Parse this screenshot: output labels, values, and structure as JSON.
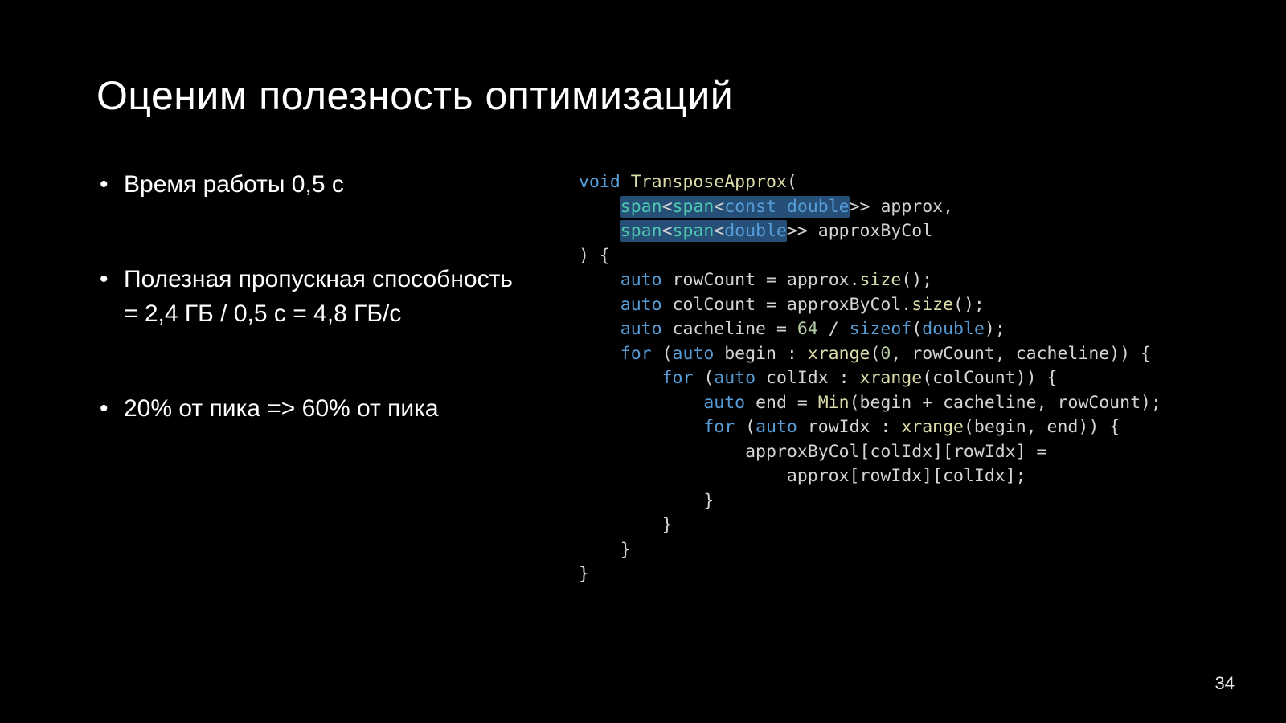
{
  "slide": {
    "title": "Оценим полезность оптимизаций",
    "bullets": [
      "Время работы 0,5 с",
      "Полезная пропускная способность = 2,4 ГБ / 0,5 с = 4,8 ГБ/с",
      "20% от пика => 60% от пика"
    ],
    "page_number": "34"
  },
  "code": {
    "l1": {
      "kw_void": "void",
      "fn": "TransposeApprox",
      "open": "("
    },
    "l2": {
      "hl_span1": "span",
      "hl_lt1": "<",
      "hl_span2": "span",
      "hl_lt2": "<",
      "hl_const": "const",
      "hl_sp": " ",
      "hl_double": "double",
      "gtgt": ">>",
      "param": " approx,"
    },
    "l3": {
      "hl_span1": "span",
      "hl_lt1": "<",
      "hl_span2": "span",
      "hl_lt2": "<",
      "hl_double": "double",
      "gtgt": ">>",
      "param": " approxByCol"
    },
    "l4": {
      "txt": ") {"
    },
    "l5": {
      "kw_auto": "auto",
      "var": " rowCount ",
      "eq": "=",
      "rhs1": " approx.",
      "fn": "size",
      "rhs2": "();"
    },
    "l6": {
      "kw_auto": "auto",
      "var": " colCount ",
      "eq": "=",
      "rhs1": " approxByCol.",
      "fn": "size",
      "rhs2": "();"
    },
    "l7": {
      "kw_auto": "auto",
      "var": " cacheline ",
      "eq": "=",
      "sp": " ",
      "n64": "64",
      "mid": " / ",
      "kw_sizeof": "sizeof",
      "op": "(",
      "type": "double",
      "close": ");"
    },
    "l8": {
      "kw_for": "for",
      "open": " (",
      "kw_auto": "auto",
      "var": " begin : ",
      "fn": "xrange",
      "args_open": "(",
      "n0": "0",
      "c1": ", rowCount, cacheline)) {"
    },
    "l9": {
      "kw_for": "for",
      "open": " (",
      "kw_auto": "auto",
      "var": " colIdx : ",
      "fn": "xrange",
      "args": "(colCount)) {"
    },
    "l10": {
      "kw_auto": "auto",
      "var": " end = ",
      "fn": "Min",
      "args": "(begin + cacheline, rowCount);"
    },
    "l11": {
      "kw_for": "for",
      "open": " (",
      "kw_auto": "auto",
      "var": " rowIdx : ",
      "fn": "xrange",
      "args": "(begin, end)) {"
    },
    "l12": {
      "txt": "approxByCol[colIdx][rowIdx] ="
    },
    "l13": {
      "txt": "approx[rowIdx][colIdx];"
    },
    "l14": {
      "txt": "}"
    },
    "l15": {
      "txt": "}"
    },
    "l16": {
      "txt": "}"
    },
    "l17": {
      "txt": "}"
    }
  }
}
